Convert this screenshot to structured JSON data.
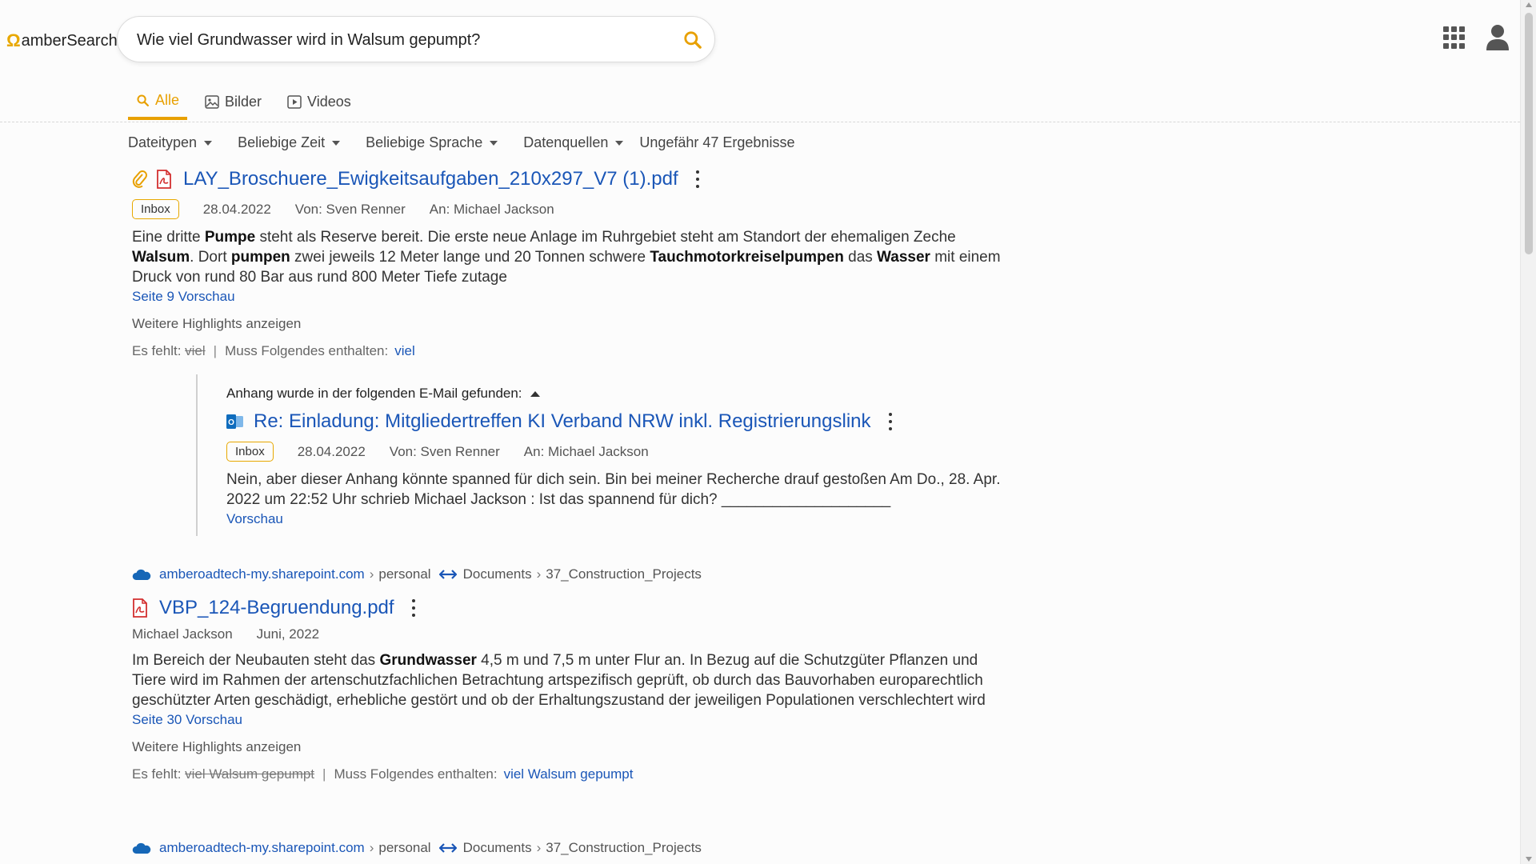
{
  "header": {
    "logo_mark": "Ω",
    "logo_text": "amberSearch",
    "search": {
      "value": "Wie viel Grundwasser wird in Walsum gepumpt?",
      "placeholder": ""
    },
    "icons": [
      "search-icon",
      "apps-grid-icon",
      "user-icon"
    ]
  },
  "tabs": [
    {
      "label": "Alle",
      "icon": "search-icon",
      "active": true
    },
    {
      "label": "Bilder",
      "icon": "image-icon",
      "active": false
    },
    {
      "label": "Videos",
      "icon": "video-icon",
      "active": false
    }
  ],
  "filters": {
    "items": [
      "Dateitypen",
      "Beliebige Zeit",
      "Beliebige Sprache",
      "Datenquellen"
    ],
    "result_count": "Ungefähr 47 Ergebnisse"
  },
  "results": [
    {
      "title": "LAY_Broschuere_Ewigkeitsaufgaben_210x297_V7 (1).pdf",
      "badge": "Inbox",
      "date": "28.04.2022",
      "from": "Von: Sven Renner",
      "to": "An: Michael Jackson",
      "snippet": {
        "p1": "Eine dritte ",
        "b1": "Pumpe",
        "p2": " steht als Reserve bereit. Die erste neue Anlage im Ruhrgebiet steht am Standort der ehemaligen Zeche ",
        "b2": "Walsum",
        "p3": ". Dort ",
        "b3": "pumpen",
        "p4": " zwei jeweils 12 Meter lange und 20 Tonnen schwere ",
        "b4": "Tauchmotorkreiselpumpen",
        "p5": " das ",
        "b5": "Wasser",
        "p6": " mit einem Druck von rund 80 Bar aus rund 800 Meter Tiefe zutage"
      },
      "preview_link": "Seite 9 Vorschau",
      "more_highlights": "Weitere Highlights anzeigen",
      "missing_label": "Es fehlt:",
      "missing_terms": "viel",
      "must_contain_label": "Muss Folgendes enthalten:",
      "must_contain_terms": "viel",
      "attachment": {
        "header": "Anhang wurde in der folgenden E-Mail gefunden:",
        "title": "Re: Einladung: Mitgliedertreffen KI Verband NRW inkl. Registrierungslink",
        "badge": "Inbox",
        "date": "28.04.2022",
        "from": "Von: Sven Renner",
        "to": "An: Michael Jackson",
        "snippet": "Nein, aber dieser Anhang könnte spanned für dich sein. Bin bei meiner Recherche drauf gestoßen Am Do., 28. Apr. 2022 um 22:52 Uhr schrieb Michael Jackson : Ist das spannend für dich? ____________________",
        "preview_link": "Vorschau"
      }
    },
    {
      "breadcrumb": {
        "host": "amberoadtech-my.sharepoint.com",
        "chev1": "›",
        "path1": "personal",
        "path2": "Documents",
        "chev2": "›",
        "path3": "37_Construction_Projects"
      },
      "title": "VBP_124-Begruendung.pdf",
      "author": "Michael Jackson",
      "date": "Juni, 2022",
      "snippet": {
        "p1": "Im Bereich der Neubauten steht das ",
        "b1": "Grundwasser",
        "p2": " 4,5 m und 7,5 m unter Flur an. In Bezug auf die Schutzgüter Pflanzen und Tiere wird im Rahmen der artenschutzfachlichen Betrachtung artspezifisch geprüft, ob durch das Bauvorhaben europarechtlich geschützter Arten geschädigt, erhebliche gestört und ob der Erhaltungszustand der jeweiligen Populationen verschlechtert wird"
      },
      "preview_link": "Seite 30 Vorschau",
      "more_highlights": "Weitere Highlights anzeigen",
      "missing_label": "Es fehlt:",
      "missing_terms": "viel Walsum gepumpt",
      "must_contain_label": "Muss Folgendes enthalten:",
      "must_contain_terms": "viel Walsum gepumpt"
    },
    {
      "breadcrumb": {
        "host": "amberoadtech-my.sharepoint.com",
        "chev1": "›",
        "path1": "personal",
        "path2": "Documents",
        "chev2": "›",
        "path3": "37_Construction_Projects"
      }
    }
  ],
  "colors": {
    "accent": "#e8a000",
    "link": "#1a56b7",
    "pdf_red": "#d32f2f",
    "outlook_blue": "#0f6cbd",
    "onedrive_blue": "#1667b7"
  }
}
